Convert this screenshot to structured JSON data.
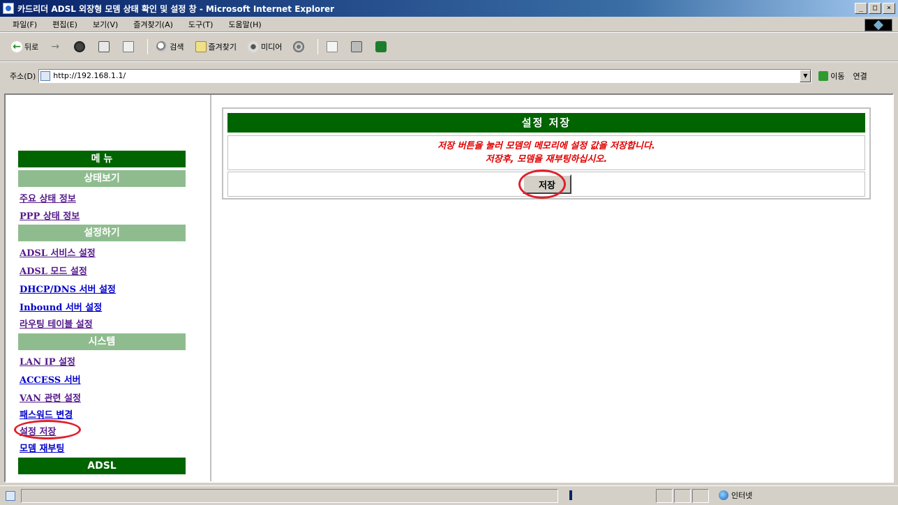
{
  "window": {
    "title": "카드리더 ADSL 외장형 모뎀 상태 확인 및 설정 창 - Microsoft Internet Explorer",
    "buttons": [
      "_",
      "□",
      "×"
    ]
  },
  "menubar": {
    "items": [
      "파일(F)",
      "편집(E)",
      "보기(V)",
      "즐겨찾기(A)",
      "도구(T)",
      "도움말(H)"
    ]
  },
  "toolbar": {
    "back": "뒤로",
    "search": "검색",
    "favorites": "즐겨찾기",
    "media": "미디어"
  },
  "address": {
    "label": "주소(D)",
    "url": "http://192.168.1.1/",
    "go": "이동",
    "links": "연결"
  },
  "sidebar": {
    "header": "메 뉴",
    "section_status": "상태보기",
    "link_main_status": "주요 상태 정보",
    "link_ppp_status": "PPP 상태 정보",
    "section_settings": "설정하기",
    "link_adsl_service": "ADSL 서비스 설정",
    "link_adsl_mode": "ADSL 모드 설정",
    "link_dhcp_dns": "DHCP/DNS 서버 설정",
    "link_inbound": "Inbound 서버 설정",
    "link_routing": "라우팅 테이블 설정",
    "section_system": "시스템",
    "link_lan_ip": "LAN IP 설정",
    "link_access": "ACCESS 서버",
    "link_van": "VAN 관련 설정",
    "link_password": "패스워드 변경",
    "link_save": "설정 저장",
    "link_reboot": "모뎀 재부팅",
    "footer": "ADSL"
  },
  "panel": {
    "title": "설정 저장",
    "message_line1": "저장 버튼을 눌러 모뎀의 메모리에 설정 값을 저장합니다.",
    "message_line2": "저장후, 모뎀을 재부팅하십시오.",
    "save_button": "저장"
  },
  "statusbar": {
    "zone": "인터넷"
  },
  "colors": {
    "menu_green": "#006400",
    "section_green": "#8fbc8f",
    "message_red": "#e00000",
    "annotation_red": "#e0202c"
  }
}
